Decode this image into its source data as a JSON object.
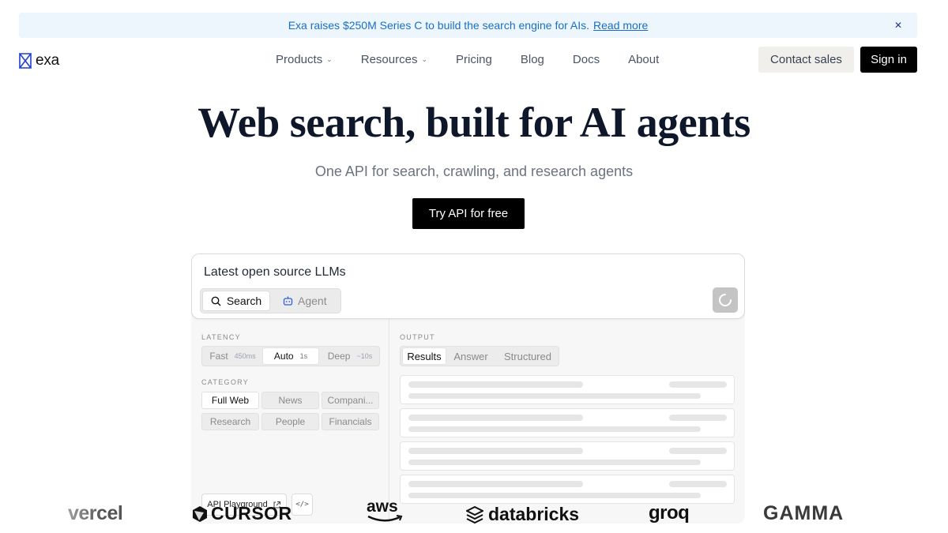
{
  "banner": {
    "text": "Exa raises $250M Series C to build the search engine for AIs.",
    "link": "Read more",
    "close_icon": "close-icon"
  },
  "nav": {
    "logo_text": "exa",
    "items": [
      {
        "label": "Products",
        "has_dropdown": true
      },
      {
        "label": "Resources",
        "has_dropdown": true
      },
      {
        "label": "Pricing"
      },
      {
        "label": "Blog"
      },
      {
        "label": "Docs"
      },
      {
        "label": "About"
      }
    ],
    "contact_label": "Contact sales",
    "signin_label": "Sign in"
  },
  "hero": {
    "title": "Web search, built for AI agents",
    "subtitle": "One API for search, crawling, and research agents",
    "cta": "Try API for free"
  },
  "demo": {
    "query": "Latest open source LLMs",
    "modes": [
      {
        "label": "Search",
        "icon": "search-icon",
        "active": true
      },
      {
        "label": "Agent",
        "icon": "robot-icon",
        "active": false
      }
    ],
    "latency_label": "LATENCY",
    "latency_options": [
      {
        "label": "Fast",
        "time": "450ms",
        "active": false
      },
      {
        "label": "Auto",
        "time": "1s",
        "active": true
      },
      {
        "label": "Deep",
        "time": "~10s",
        "active": false
      }
    ],
    "category_label": "CATEGORY",
    "categories": [
      {
        "label": "Full Web",
        "active": true
      },
      {
        "label": "News",
        "active": false
      },
      {
        "label": "Compani...",
        "active": false
      },
      {
        "label": "Research",
        "active": false
      },
      {
        "label": "People",
        "active": false
      },
      {
        "label": "Financials",
        "active": false
      }
    ],
    "api_playground": "API Playground",
    "code_label": "</>",
    "output_label": "OUTPUT",
    "output_tabs": [
      {
        "label": "Results",
        "active": true
      },
      {
        "label": "Answer",
        "active": false
      },
      {
        "label": "Structured",
        "active": false
      }
    ]
  },
  "logos": {
    "items": [
      "vercel",
      "CURSOR",
      "aws",
      "databricks",
      "groq",
      "GAMMA"
    ]
  },
  "colors": {
    "banner_bg": "#eef6fd",
    "banner_text": "#1a6fc4",
    "brand_blue": "#1f3fd6",
    "primary_button": "#000000"
  }
}
